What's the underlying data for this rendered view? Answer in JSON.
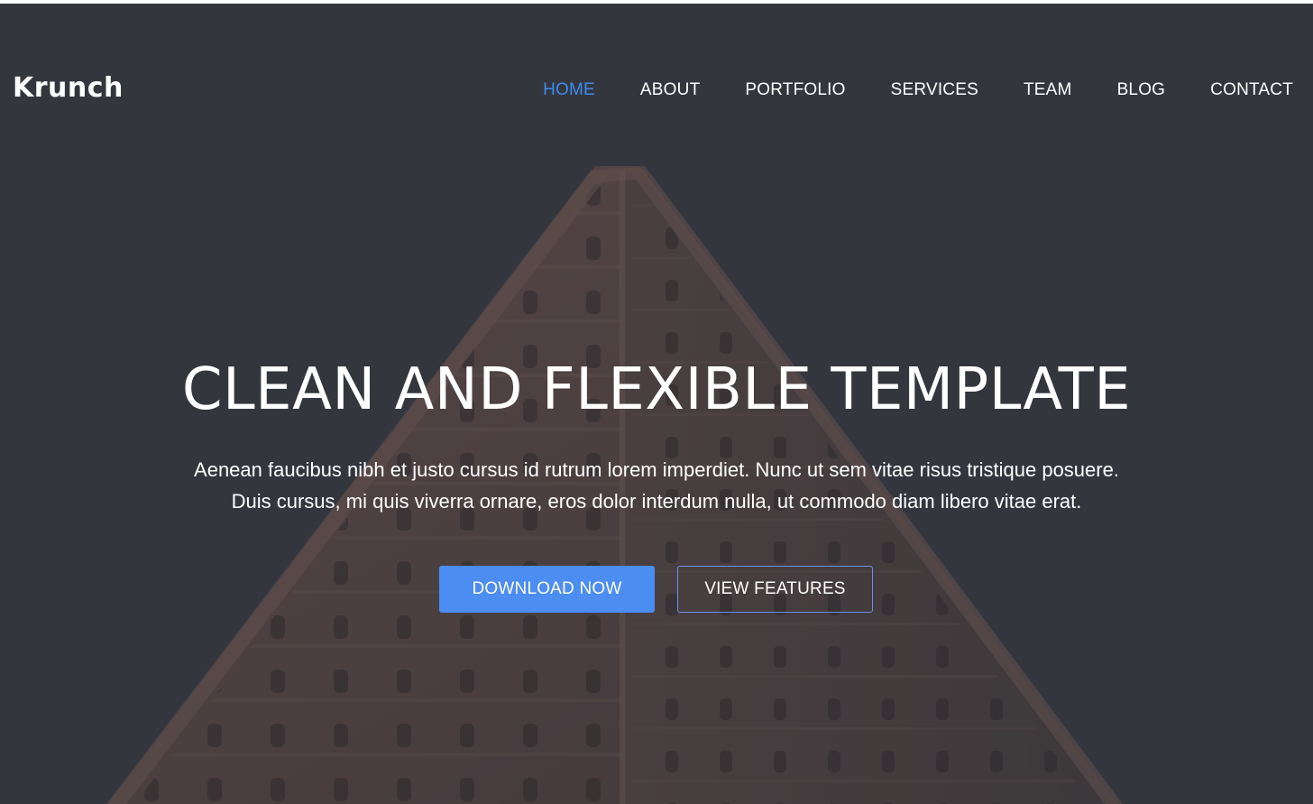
{
  "brand": {
    "logo_text": "Krunch",
    "accent_color": "#3d8cf0",
    "button_color": "#4c8df2"
  },
  "nav": {
    "items": [
      {
        "label": "HOME",
        "active": true
      },
      {
        "label": "ABOUT",
        "active": false
      },
      {
        "label": "PORTFOLIO",
        "active": false
      },
      {
        "label": "SERVICES",
        "active": false
      },
      {
        "label": "TEAM",
        "active": false
      },
      {
        "label": "BLOG",
        "active": false
      },
      {
        "label": "CONTACT",
        "active": false
      }
    ]
  },
  "hero": {
    "headline": "CLEAN AND FLEXIBLE TEMPLATE",
    "subtext_line1": "Aenean faucibus nibh et justo cursus id rutrum lorem imperdiet. Nunc ut sem vitae risus tristique posuere.",
    "subtext_line2": "Duis cursus, mi quis viverra ornare, eros dolor interdum nulla, ut commodo diam libero vitae erat.",
    "primary_button": "DOWNLOAD NOW",
    "secondary_button": "VIEW FEATURES",
    "background_image": "flatiron-building-photo"
  }
}
